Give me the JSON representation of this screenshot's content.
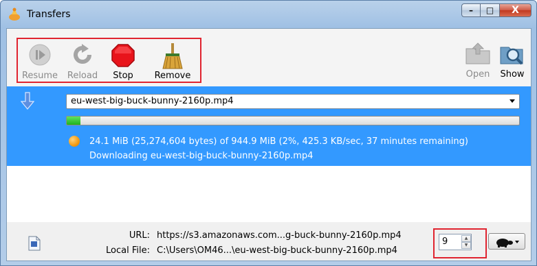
{
  "window": {
    "title": "Transfers",
    "minimize_glyph": "–",
    "maximize_glyph": "□",
    "close_glyph": "X"
  },
  "toolbar": {
    "resume_label": "Resume",
    "reload_label": "Reload",
    "stop_label": "Stop",
    "remove_label": "Remove",
    "open_label": "Open",
    "show_label": "Show"
  },
  "transfer": {
    "file_name": "eu-west-big-buck-bunny-2160p.mp4",
    "progress_fraction": 0.02,
    "status": "24.1 MiB (25,274,604 bytes) of 944.9 MiB (2%, 425.3 KB/sec, 37 minutes remaining)",
    "detail": "Downloading eu-west-big-buck-bunny-2160p.mp4"
  },
  "details": {
    "url_label": "URL:",
    "url_value": "https://s3.amazonaws.com...g-buck-bunny-2160p.mp4",
    "local_label": "Local File:",
    "local_value": "C:\\Users\\OM46...\\eu-west-big-buck-bunny-2160p.mp4",
    "connections_value": "9"
  },
  "colors": {
    "selection": "#3399ff",
    "highlight_border": "#e0232f",
    "progress_fill": "#1fb21f"
  },
  "icons": {
    "app": "transfer-app-icon",
    "resume": "resume-icon",
    "reload": "reload-icon",
    "stop": "stop-icon",
    "remove": "broom-icon",
    "open": "open-folder-icon",
    "show": "magnifier-folder-icon",
    "download": "download-arrow-icon",
    "status": "status-orange-icon",
    "file": "file-icon",
    "speed": "turtle-icon"
  }
}
